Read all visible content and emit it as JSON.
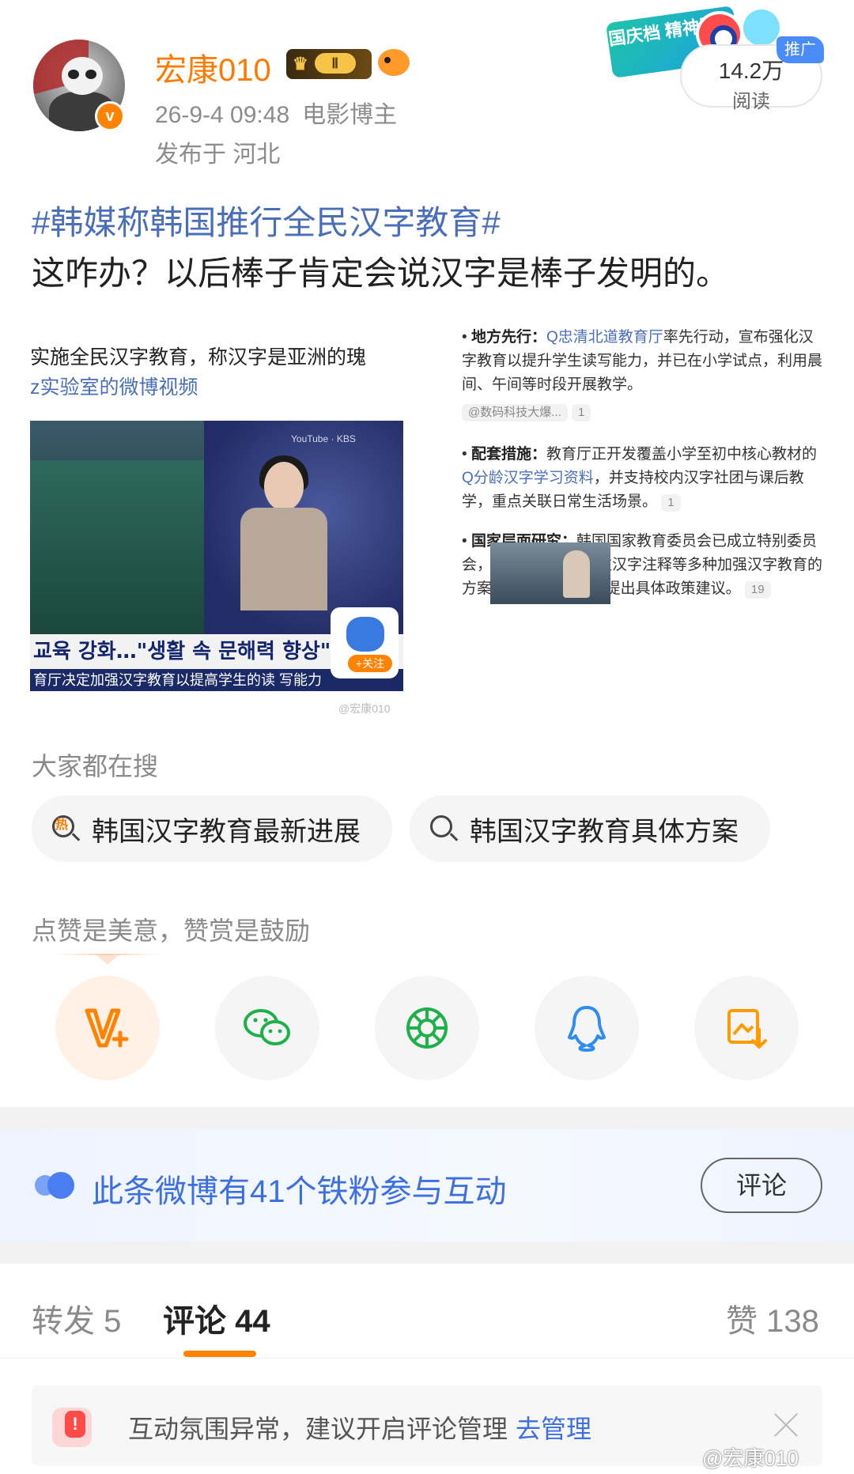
{
  "header": {
    "username": "宏康010",
    "user_level": "Ⅱ",
    "post_time": "26-9-4 09:48",
    "user_role": "电影博主",
    "location": "发布于 河北",
    "ad_banner": "国庆档 精神股东",
    "read_count": "14.2万",
    "read_label": "阅读",
    "promo_tag": "推广"
  },
  "post": {
    "hashtag": "#韩媒称韩国推行全民汉字教育#",
    "text": "这咋办？以后棒子肯定会说汉字是棒子发明的。"
  },
  "image": {
    "caption_line1": "实施全民汉字教育，称汉字是亚洲的瑰",
    "caption_line2": "z实验室的微博视频",
    "video_lower_third": "교육 강화…\"생활 속 문해력 향상\"",
    "video_ticker": "育厅决定加强汉字教育以提高学生的读 写能力",
    "video_follow": "+关注",
    "watermark": "@宏康010",
    "bullets": [
      {
        "title": "地方先行：",
        "link": "Q忠清北道教育厅",
        "text": "率先行动，宣布强化汉字教育以提升学生读写能力，并已在小学试点，利用晨间、午间等时段开展教学。",
        "source": "@数码科技大爆...",
        "count": "1"
      },
      {
        "title": "配套措施：",
        "text_pre": "教育厅正开发覆盖小学至初中核心教材的",
        "link": "Q分龄汉字学习资料",
        "text": "，并支持校内汉字社团与课后教学，重点关联日常生活场景。",
        "count": "1"
      },
      {
        "title": "国家层面研究：",
        "text": "韩国国家教育委员会已成立特别委员会，研究在教材中标注汉字注释等多种加强汉字教育的方案，计划在6个月内提出具体政策建议。",
        "count": "19"
      }
    ]
  },
  "search": {
    "title": "大家都在搜",
    "hot_badge": "热",
    "chips": [
      "韩国汉字教育最新进展",
      "韩国汉字教育具体方案"
    ]
  },
  "reward": {
    "caption": "点赞是美意，赞赏是鼓励"
  },
  "share": {
    "icons": [
      "v-plus-icon",
      "wechat-icon",
      "moments-icon",
      "qq-icon",
      "save-image-icon"
    ]
  },
  "fan_banner": {
    "text": "此条微博有41个铁粉参与互动",
    "button": "评论"
  },
  "tabs": {
    "repost": "转发 5",
    "comments": "评论 44",
    "likes": "赞 138"
  },
  "notice": {
    "text": "互动氛围异常，建议开启评论管理",
    "link": "去管理"
  },
  "footer_watermark": "@宏康010",
  "colors": {
    "accent_orange": "#ff8200",
    "link_blue": "#4a6fb8",
    "banner_blue": "#3d6fe0"
  }
}
